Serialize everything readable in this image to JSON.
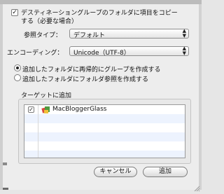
{
  "options": {
    "copy_items_label_line1": "デスティネーショングループのフォルダに項目をコピー",
    "copy_items_label_line2": "する（必要な場合）",
    "copy_items_checked": true
  },
  "reference_type": {
    "label": "参照タイプ：",
    "value": "デフォルト"
  },
  "encoding": {
    "label": "エンコーディング：",
    "value": "Unicode（UTF-8）"
  },
  "folder_mode": {
    "recursive_groups_label": "追加したフォルダに再帰的にグループを作成する",
    "folder_references_label": "追加したフォルダにフォルダ参照を作成する",
    "selected": "recursive_groups"
  },
  "targets": {
    "title": "ターゲットに追加",
    "items": [
      {
        "name": "MacBloggerGlass",
        "checked": true,
        "icon": "target-app-icon"
      }
    ]
  },
  "buttons": {
    "cancel": "キャンセル",
    "add": "追加"
  }
}
